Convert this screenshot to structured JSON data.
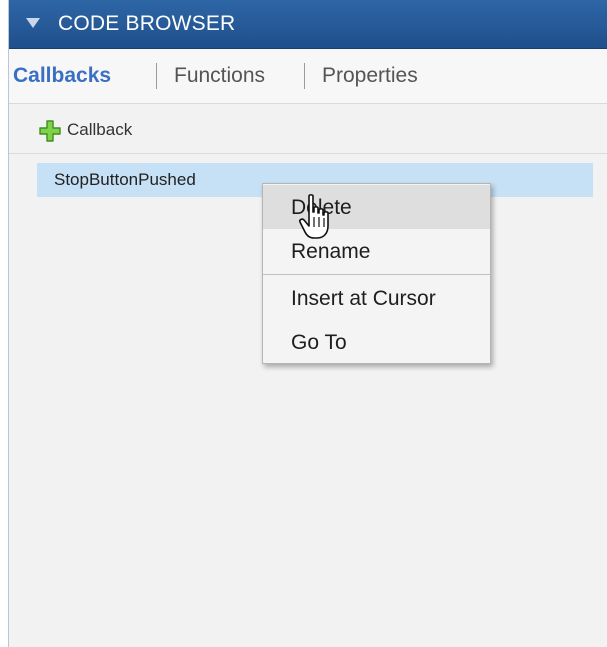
{
  "titlebar": {
    "title": "CODE BROWSER",
    "collapse_icon": "triangle-down-icon"
  },
  "tabs": [
    {
      "label": "Callbacks",
      "active": true
    },
    {
      "label": "Functions",
      "active": false
    },
    {
      "label": "Properties",
      "active": false
    }
  ],
  "toolbar": {
    "add_label": "Callback",
    "add_icon": "green-plus-icon"
  },
  "list": {
    "items": [
      {
        "label": "StopButtonPushed",
        "selected": true
      }
    ]
  },
  "context_menu": {
    "items": [
      {
        "label": "Delete",
        "highlighted": true
      },
      {
        "label": "Rename",
        "highlighted": false
      },
      {
        "label": "Insert at Cursor",
        "highlighted": false
      },
      {
        "label": "Go To",
        "highlighted": false
      }
    ]
  },
  "colors": {
    "titlebar": "#2e66a6",
    "active_tab": "#3a6fc4",
    "selection": "#c6e0f5",
    "plus": "#6cc23a"
  },
  "cursor_icon": "hand-pointer-icon"
}
